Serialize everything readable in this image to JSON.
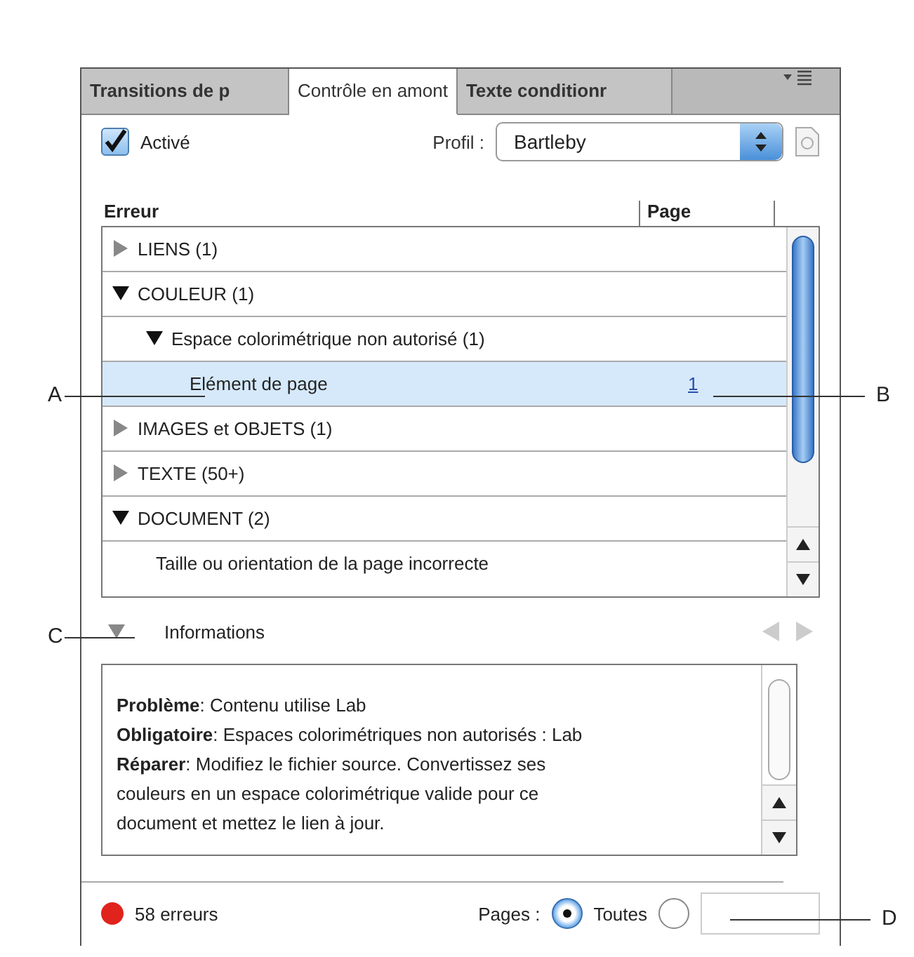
{
  "tabs": [
    {
      "label": "Transitions de p",
      "selected": false
    },
    {
      "label": "Contrôle en amont",
      "selected": true
    },
    {
      "label": "Texte conditionr",
      "selected": false
    }
  ],
  "enabled": {
    "label": "Activé",
    "checked": true
  },
  "profile": {
    "label": "Profil :",
    "value": "Bartleby"
  },
  "columns": [
    "Erreur",
    "Page"
  ],
  "tree": [
    {
      "kind": "group",
      "label": "LIENS (1)",
      "expanded": false,
      "selected": false
    },
    {
      "kind": "group",
      "label": "COULEUR (1)",
      "expanded": true,
      "selected": false,
      "children": [
        {
          "kind": "group",
          "label": "Espace colorimétrique non autorisé (1)",
          "expanded": true,
          "selected": false,
          "children": [
            {
              "kind": "leaf",
              "label": "Elément de page",
              "page": "1",
              "selected": true
            }
          ]
        }
      ]
    },
    {
      "kind": "group",
      "label": "IMAGES et OBJETS (1)",
      "expanded": false,
      "selected": false
    },
    {
      "kind": "group",
      "label": "TEXTE (50+)",
      "expanded": false,
      "selected": false
    },
    {
      "kind": "group",
      "label": "DOCUMENT (2)",
      "expanded": true,
      "selected": false,
      "children": [
        {
          "kind": "leaf",
          "label": "Taille ou orientation de la page incorrecte",
          "selected": false
        }
      ]
    }
  ],
  "info": {
    "title": "Informations",
    "expanded": true,
    "lines": [
      "**Problème**: Contenu utilise Lab",
      "**Obligatoire**: Espaces colorimétriques non autorisés : Lab",
      "**Réparer**: Modifiez le fichier source. Convertissez ses couleurs en un espace colorimétrique valide pour ce document et mettez le lien à jour."
    ]
  },
  "status": {
    "errors": "58 erreurs",
    "color": "#e0231c"
  },
  "pages": {
    "label": "Pages :",
    "options": [
      {
        "kind": "radio",
        "label": "Toutes",
        "selected": true
      },
      {
        "kind": "range",
        "selected": false
      }
    ]
  },
  "callouts": [
    "A",
    "B",
    "C",
    "D"
  ]
}
